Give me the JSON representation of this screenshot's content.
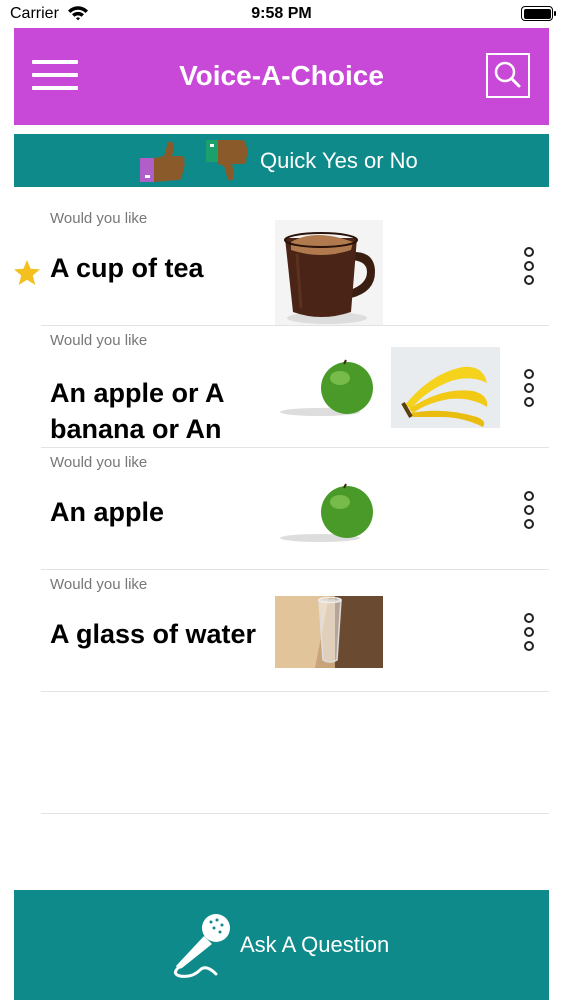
{
  "status_bar": {
    "carrier": "Carrier",
    "time": "9:58 PM"
  },
  "header": {
    "title": "Voice-A-Choice",
    "color": "#c848d8"
  },
  "quick_bar": {
    "label": "Quick Yes or No",
    "color": "#0e8a8a"
  },
  "choices": [
    {
      "prefix": "Would you like",
      "title": "A cup of tea",
      "favorite": true,
      "images": [
        "tea-cup"
      ]
    },
    {
      "prefix": "Would you like",
      "title_lines": [
        "An apple or A",
        "banana or An"
      ],
      "favorite": false,
      "images": [
        "green-apple",
        "bananas"
      ]
    },
    {
      "prefix": "Would you like",
      "title": "An apple",
      "favorite": false,
      "images": [
        "green-apple"
      ]
    },
    {
      "prefix": "Would you like",
      "title": "A glass of water",
      "favorite": false,
      "images": [
        "water-glass"
      ]
    }
  ],
  "ask_bar": {
    "label": "Ask A Question",
    "color": "#0e8a8a"
  }
}
